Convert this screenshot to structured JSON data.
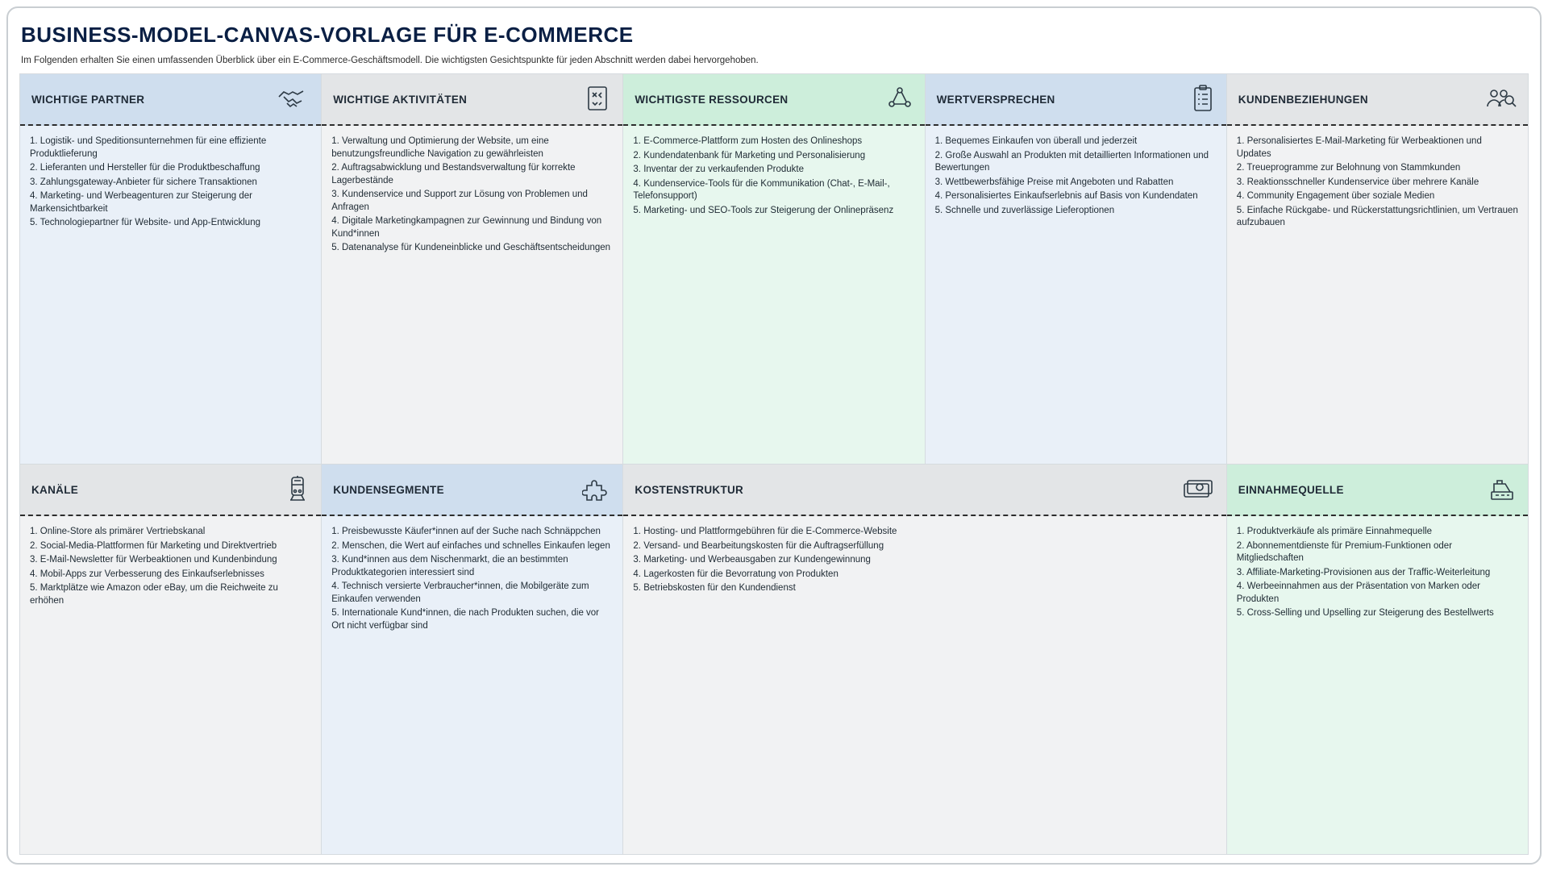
{
  "title": "BUSINESS-MODEL-CANVAS-VORLAGE FÜR E-COMMERCE",
  "subtitle": "Im Folgenden erhalten Sie einen umfassenden Überblick über ein E-Commerce-Geschäftsmodell. Die wichtigsten Gesichtspunkte für jeden Abschnitt werden dabei hervorgehoben.",
  "sections": {
    "partners": {
      "label": "WICHTIGE PARTNER",
      "items": [
        "Logistik- und Speditionsunternehmen für eine effiziente Produktlieferung",
        "Lieferanten und Hersteller für die Produktbeschaffung",
        "Zahlungsgateway-Anbieter für sichere Transaktionen",
        "Marketing- und Werbeagenturen zur Steigerung der Markensichtbarkeit",
        "Technologiepartner für Website- und App-Entwicklung"
      ]
    },
    "activities": {
      "label": "WICHTIGE AKTIVITÄTEN",
      "items": [
        "Verwaltung und Optimierung der Website, um eine benutzungsfreundliche Navigation zu gewährleisten",
        " Auftragsabwicklung und Bestandsverwaltung für korrekte Lagerbestände",
        "Kundenservice und Support zur Lösung von Problemen und Anfragen",
        "Digitale Marketingkampagnen zur Gewinnung und Bindung von Kund*innen",
        "Datenanalyse für Kundeneinblicke und Geschäftsentscheidungen"
      ]
    },
    "resources": {
      "label": "WICHTIGSTE RESSOURCEN",
      "items": [
        "E-Commerce-Plattform zum Hosten des Onlineshops",
        "Kundendatenbank für Marketing und Personalisierung",
        "Inventar der zu verkaufenden Produkte",
        "Kundenservice-Tools für die Kommunikation (Chat-, E-Mail-, Telefonsupport)",
        "Marketing- und SEO-Tools zur Steigerung der Onlinepräsenz"
      ]
    },
    "value": {
      "label": "WERTVERSPRECHEN",
      "items": [
        "Bequemes Einkaufen von überall und jederzeit",
        "Große Auswahl an Produkten mit detaillierten Informationen und Bewertungen",
        "Wettbewerbsfähige Preise mit Angeboten und Rabatten",
        "Personalisiertes Einkaufserlebnis auf Basis von Kundendaten",
        "Schnelle und zuverlässige Lieferoptionen"
      ]
    },
    "relations": {
      "label": "KUNDENBEZIEHUNGEN",
      "items": [
        "Personalisiertes E-Mail-Marketing für Werbeaktionen und Updates",
        "Treueprogramme zur Belohnung von Stammkunden",
        "Reaktionsschneller Kundenservice über mehrere Kanäle",
        "Community Engagement über soziale Medien",
        "Einfache Rückgabe- und Rückerstattungsrichtlinien, um Vertrauen aufzubauen"
      ]
    },
    "channels": {
      "label": "KANÄLE",
      "items": [
        "Online-Store als primärer Vertriebskanal",
        "Social-Media-Plattformen für Marketing und Direktvertrieb",
        "E-Mail-Newsletter für Werbeaktionen und Kundenbindung",
        "Mobil-Apps zur Verbesserung des Einkaufserlebnisses",
        "Marktplätze wie Amazon oder eBay, um die Reichweite zu erhöhen"
      ]
    },
    "segments": {
      "label": "KUNDENSEGMENTE",
      "items": [
        "Preisbewusste Käufer*innen auf der Suche nach Schnäppchen",
        "Menschen, die Wert auf einfaches und schnelles Einkaufen legen",
        "Kund*innen aus dem Nischenmarkt, die an bestimmten Produktkategorien interessiert sind",
        "Technisch versierte Verbraucher*innen, die Mobilgeräte zum Einkaufen verwenden",
        "Internationale Kund*innen, die nach Produkten suchen, die vor Ort nicht verfügbar sind"
      ]
    },
    "costs": {
      "label": "KOSTENSTRUKTUR",
      "items": [
        "Hosting- und Plattformgebühren für die E-Commerce-Website",
        "Versand- und Bearbeitungskosten für die Auftragserfüllung",
        "Marketing- und Werbeausgaben zur Kundengewinnung",
        "Lagerkosten für die Bevorratung von Produkten",
        "Betriebskosten für den Kundendienst"
      ]
    },
    "revenue": {
      "label": "EINNAHMEQUELLE",
      "items": [
        "Produktverkäufe als primäre Einnahmequelle",
        "Abonnementdienste für Premium-Funktionen oder Mitgliedschaften",
        "Affiliate-Marketing-Provisionen aus der Traffic-Weiterleitung",
        "Werbeeinnahmen aus der Präsentation von Marken oder Produkten",
        "Cross-Selling und Upselling zur Steigerung des Bestellwerts"
      ]
    }
  }
}
